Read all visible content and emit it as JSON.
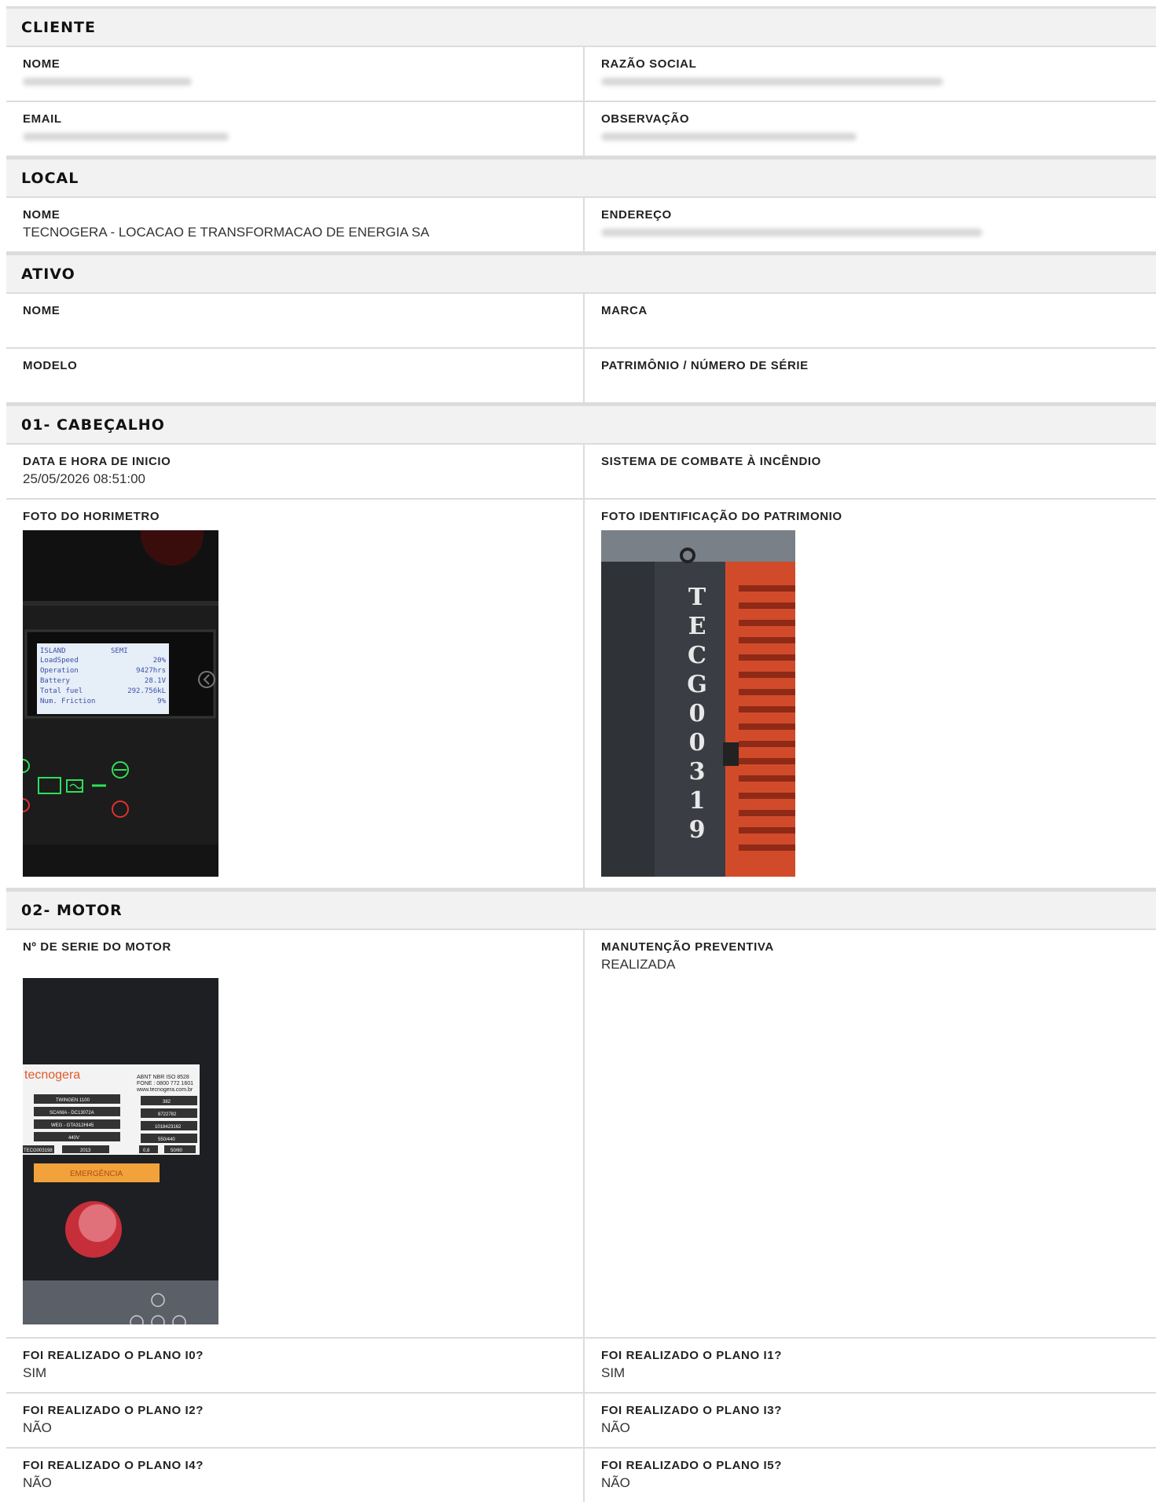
{
  "cliente": {
    "title": "CLIENTE",
    "nome_label": "NOME",
    "razao_label": "RAZÃO SOCIAL",
    "email_label": "EMAIL",
    "obs_label": "OBSERVAÇÃO"
  },
  "local": {
    "title": "LOCAL",
    "nome_label": "NOME",
    "nome_value": "TECNOGERA - LOCACAO E TRANSFORMACAO DE ENERGIA SA",
    "endereco_label": "ENDEREÇO"
  },
  "ativo": {
    "title": "ATIVO",
    "nome_label": "NOME",
    "marca_label": "MARCA",
    "modelo_label": "MODELO",
    "patrimonio_label": "PATRIMÔNIO / NÚMERO DE SÉRIE"
  },
  "cabecalho": {
    "title": "01- CABEÇALHO",
    "data_label": "DATA E HORA DE INICIO",
    "data_value": "25/05/2026 08:51:00",
    "sistema_label": "SISTEMA DE COMBATE À INCÊNDIO",
    "foto_horimetro_label": "FOTO DO HORIMETRO",
    "foto_patrimonio_label": "FOTO IDENTIFICAÇÃO DO PATRIMONIO",
    "horimetro_screen": {
      "mode_left": "ISLAND",
      "mode_right": "SEMI",
      "rows": [
        {
          "name": "LoadSpeed",
          "val": "20%"
        },
        {
          "name": "Operation",
          "val": "9427hrs"
        },
        {
          "name": "Battery",
          "val": "28.1V"
        },
        {
          "name": "Total fuel",
          "val": "292.756kL"
        },
        {
          "name": "Num. Friction",
          "val": "9%"
        }
      ]
    },
    "patrimonio_text": "TECG00319"
  },
  "motor": {
    "title": "02- MOTOR",
    "serie_label": "Nº DE SERIE DO MOTOR",
    "manutencao_label": "MANUTENÇÃO PREVENTIVA",
    "manutencao_value": "REALIZADA",
    "plate": {
      "brand": "tecnogera",
      "std": "ABNT NBR ISO 8528",
      "phone": "FONE : 0800 772 1601",
      "site": "www.tecnogera.com.br",
      "r1": "TWINGEN 1100",
      "r1v": "382",
      "r2": "SCANIA - DC13072A",
      "r2v": "8722782",
      "r3": "WEG - GTA312HI45",
      "r3v": "1018423162",
      "r4": "440V",
      "r4v": "550/440",
      "pat": "TECG003198",
      "fab": "2013",
      "fp": "0,8",
      "freq": "50/60",
      "emerg": "EMERGÊNCIA"
    },
    "planos": [
      {
        "label": "FOI REALIZADO O PLANO I0?",
        "value": "SIM"
      },
      {
        "label": "FOI REALIZADO O PLANO I1?",
        "value": "SIM"
      },
      {
        "label": "FOI REALIZADO O PLANO I2?",
        "value": "NÃO"
      },
      {
        "label": "FOI REALIZADO O PLANO I3?",
        "value": "NÃO"
      },
      {
        "label": "FOI REALIZADO O PLANO I4?",
        "value": "NÃO"
      },
      {
        "label": "FOI REALIZADO O PLANO I5?",
        "value": "NÃO"
      }
    ]
  }
}
